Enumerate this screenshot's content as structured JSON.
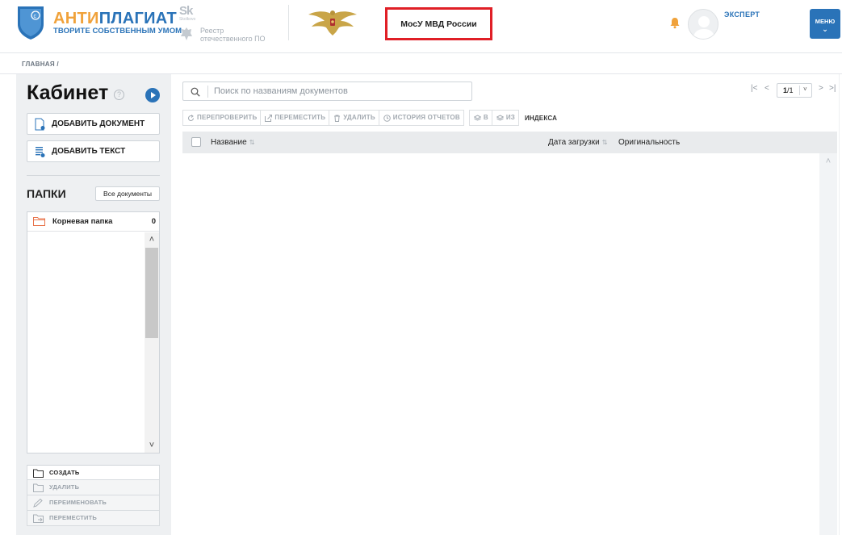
{
  "header": {
    "brand_part1": "АНТИ",
    "brand_part2": "ПЛАГИАТ",
    "brand_tagline": "ТВОРИТЕ СОБСТВЕННЫМ УМОМ",
    "skolkovo_mark": "Sk",
    "skolkovo_small": "Skolkovo",
    "registry_line1": "Реестр",
    "registry_line2": "отечественного ПО",
    "organization": "МосУ МВД России",
    "user_role": "ЭКСПЕРТ",
    "menu_label": "МЕНЮ",
    "menu_chevron": "⌄"
  },
  "breadcrumb": "ГЛАВНАЯ /",
  "sidebar": {
    "title": "Кабинет",
    "help": "?",
    "add_document": "ДОБАВИТЬ ДОКУМЕНТ",
    "add_text": "ДОБАВИТЬ ТЕКСТ",
    "folders_title": "ПАПКИ",
    "all_documents": "Все документы",
    "root_folder": {
      "name": "Корневая папка",
      "count": "0"
    },
    "actions": [
      "СОЗДАТЬ",
      "УДАЛИТЬ",
      "ПЕРЕИМЕНОВАТЬ",
      "ПЕРЕМЕСТИТЬ"
    ]
  },
  "search": {
    "placeholder": "Поиск по названиям документов"
  },
  "pager": {
    "first": "|<",
    "prev": "<",
    "current": "1",
    "total": "/1",
    "next": ">",
    "last": ">|"
  },
  "toolbar": {
    "recheck": "ПЕРЕПРОВЕРИТЬ",
    "move": "ПЕРЕМЕСТИТЬ",
    "delete": "УДАЛИТЬ",
    "history": "ИСТОРИЯ ОТЧЕТОВ",
    "to_index": "В",
    "from_index": "ИЗ",
    "index_label": "ИНДЕКСА"
  },
  "table": {
    "col_name": "Название",
    "col_date": "Дата загрузки",
    "col_originality": "Оригинальность",
    "rows": []
  },
  "colors": {
    "brand_blue": "#2a73b8",
    "brand_orange": "#f0a23b",
    "highlight_red": "#e01f26"
  }
}
